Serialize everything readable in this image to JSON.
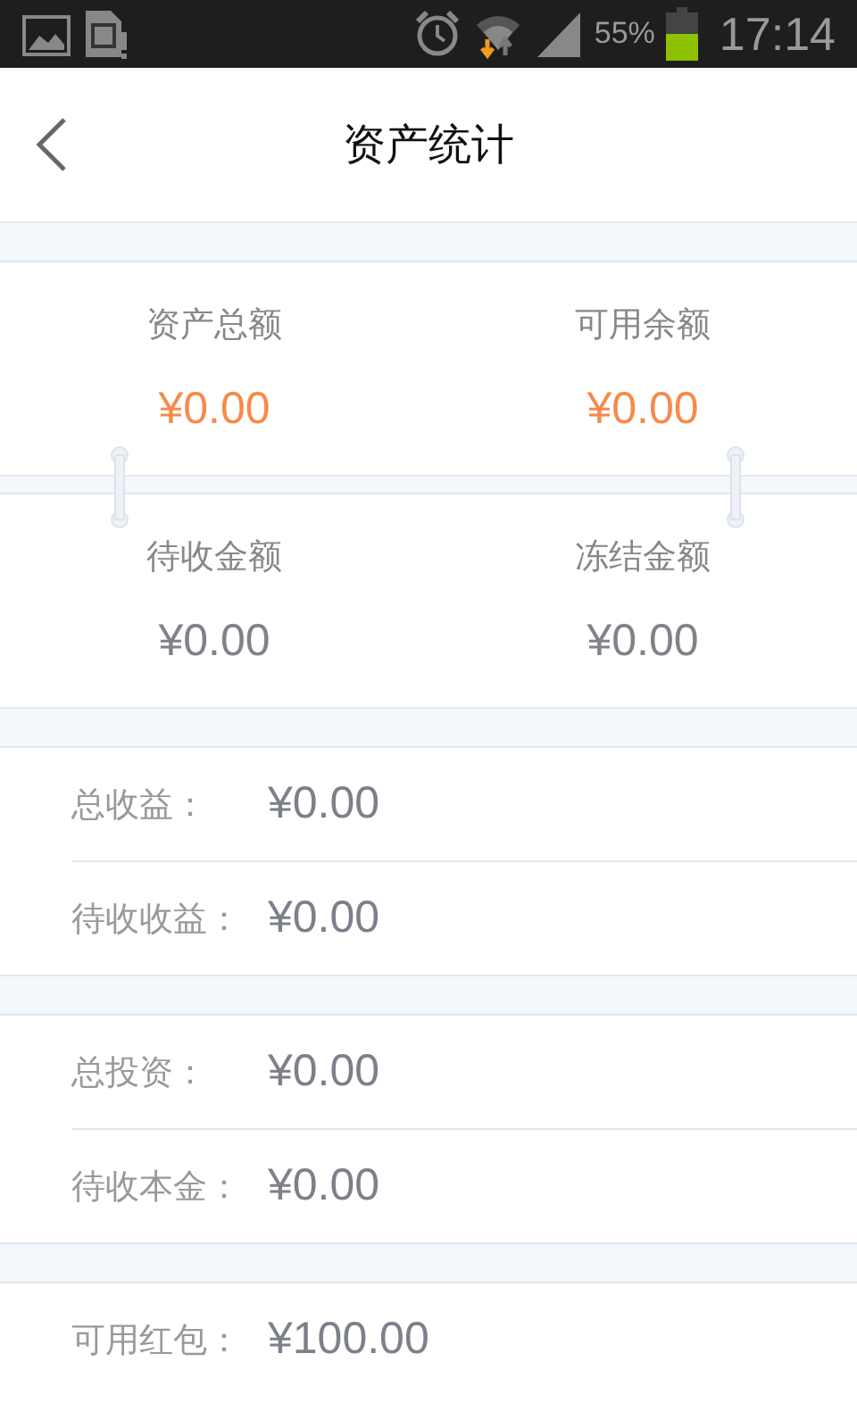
{
  "status_bar": {
    "battery": "55%",
    "time": "17:14"
  },
  "header": {
    "title": "资产统计"
  },
  "summary_cards": [
    {
      "items": [
        {
          "label": "资产总额",
          "value": "¥0.00",
          "highlighted": true
        },
        {
          "label": "可用余额",
          "value": "¥0.00",
          "highlighted": true
        }
      ]
    },
    {
      "items": [
        {
          "label": "待收金额",
          "value": "¥0.00",
          "highlighted": false
        },
        {
          "label": "冻结金额",
          "value": "¥0.00",
          "highlighted": false
        }
      ]
    }
  ],
  "groups": [
    {
      "rows": [
        {
          "label": "总收益：",
          "value": "¥0.00"
        },
        {
          "label": "待收收益：",
          "value": "¥0.00"
        }
      ]
    },
    {
      "rows": [
        {
          "label": "总投资：",
          "value": "¥0.00"
        },
        {
          "label": "待收本金：",
          "value": "¥0.00"
        }
      ]
    },
    {
      "rows": [
        {
          "label": "可用红包：",
          "value": "¥100.00"
        }
      ]
    }
  ]
}
